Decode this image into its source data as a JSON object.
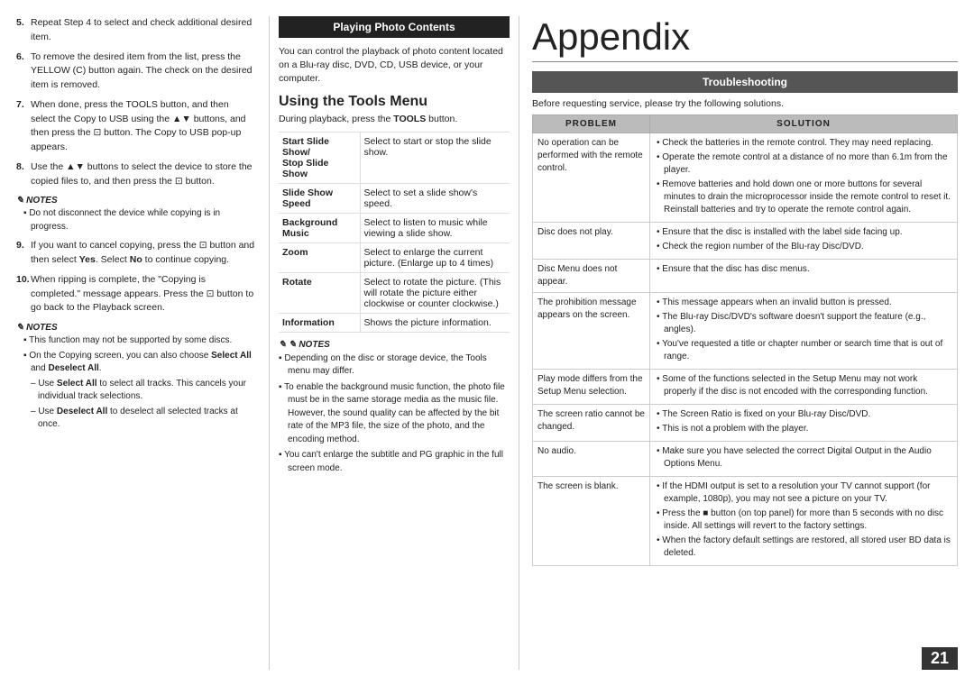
{
  "left": {
    "items": [
      {
        "num": "5.",
        "text": "Repeat Step 4 to select and check additional desired item."
      },
      {
        "num": "6.",
        "text": "To remove the desired item from the list, press the YELLOW (C) button again. The check on the desired item is removed."
      },
      {
        "num": "7.",
        "text": "When done, press the TOOLS button, and then select the Copy to USB using the ▲▼ buttons, and then press the ⊡ button. The Copy to USB pop-up appears."
      },
      {
        "num": "8.",
        "text": "Use the ▲▼ buttons to select the device to store the copied files to, and then press the ⊡ button."
      }
    ],
    "notes1": {
      "header": "NOTES",
      "items": [
        "Do not disconnect the device while copying is in progress."
      ]
    },
    "item9": {
      "num": "9.",
      "text": "If you want to cancel copying, press the ⊡ button and then select Yes. Select No to continue copying."
    },
    "item10": {
      "num": "10.",
      "text": "When ripping is complete, the \"Copying is completed.\" message appears. Press the ⊡ button to go back to the Playback screen."
    },
    "notes2": {
      "header": "NOTES",
      "items": [
        "This function may not be supported by some discs.",
        "On the Copying screen, you can also choose Select All and Deselect All.",
        "– Use Select All to select all tracks. This cancels your individual track selections.",
        "– Use Deselect All to deselect all selected tracks at once."
      ]
    }
  },
  "mid": {
    "section_header": "Playing Photo Contents",
    "intro": "You can control the playback of photo content located on a Blu-ray disc, DVD, CD, USB device, or your computer.",
    "using_tools_title": "Using the Tools Menu",
    "using_tools_intro": "During playback, press the TOOLS button.",
    "tools_rows": [
      {
        "label": "Start Slide Show/ Stop Slide Show",
        "desc": "Select to start or stop the slide show."
      },
      {
        "label": "Slide Show Speed",
        "desc": "Select to set a slide show's speed."
      },
      {
        "label": "Background Music",
        "desc": "Select to listen to music while viewing a slide show."
      },
      {
        "label": "Zoom",
        "desc": "Select to enlarge the current picture. (Enlarge up to 4 times)"
      },
      {
        "label": "Rotate",
        "desc": "Select to rotate the picture. (This will rotate the picture either clockwise or counter clockwise.)"
      },
      {
        "label": "Information",
        "desc": "Shows the picture information."
      }
    ],
    "notes": {
      "header": "NOTES",
      "items": [
        "Depending on the disc or storage device, the Tools menu may differ.",
        "To enable the background music function, the photo file must be in the same storage media as the music file. However, the sound quality can be affected by the bit rate of the MP3 file, the size of the photo, and the encoding method.",
        "You can't enlarge the subtitle and PG graphic in the full screen mode."
      ]
    }
  },
  "right": {
    "appendix_title": "Appendix",
    "troubleshooting_header": "Troubleshooting",
    "before_text": "Before requesting service, please try the following solutions.",
    "table_headers": [
      "PROBLEM",
      "SOLUTION"
    ],
    "rows": [
      {
        "problem": "No operation can be performed with the remote control.",
        "solutions": [
          "Check the batteries in the remote control. They may need replacing.",
          "Operate the remote control at a distance of no more than 6.1m from the player.",
          "Remove batteries and hold down one or more buttons for several minutes to drain the microprocessor inside the remote control to reset it. Reinstall batteries and try to operate the remote control again."
        ]
      },
      {
        "problem": "Disc does not play.",
        "solutions": [
          "Ensure that the disc is installed with the label side facing up.",
          "Check the region number of the Blu-ray Disc/DVD."
        ]
      },
      {
        "problem": "Disc Menu does not appear.",
        "solutions": [
          "Ensure that the disc has disc menus."
        ]
      },
      {
        "problem": "The prohibition message appears on the screen.",
        "solutions": [
          "This message appears when an invalid button is pressed.",
          "The Blu-ray Disc/DVD's software doesn't support the feature (e.g., angles).",
          "You've requested a title or chapter number or search time that is out of range."
        ]
      },
      {
        "problem": "Play mode differs from the Setup Menu selection.",
        "solutions": [
          "Some of the functions selected in the Setup Menu may not work properly if the disc is not encoded with the corresponding function."
        ]
      },
      {
        "problem": "The screen ratio cannot be changed.",
        "solutions": [
          "The Screen Ratio is fixed on your Blu-ray Disc/DVD.",
          "This is not a problem with the player."
        ]
      },
      {
        "problem": "No audio.",
        "solutions": [
          "Make sure you have selected the correct Digital Output in the Audio Options Menu."
        ]
      },
      {
        "problem": "The screen is blank.",
        "solutions": [
          "If the HDMI output is set to a resolution your TV cannot support (for example, 1080p), you may not see a picture on your TV.",
          "Press the ■ button (on top panel) for more than 5 seconds with no disc inside. All settings will revert to the factory settings.",
          "When the factory default settings are restored, all stored user BD data is deleted."
        ]
      }
    ],
    "page_number": "21"
  }
}
